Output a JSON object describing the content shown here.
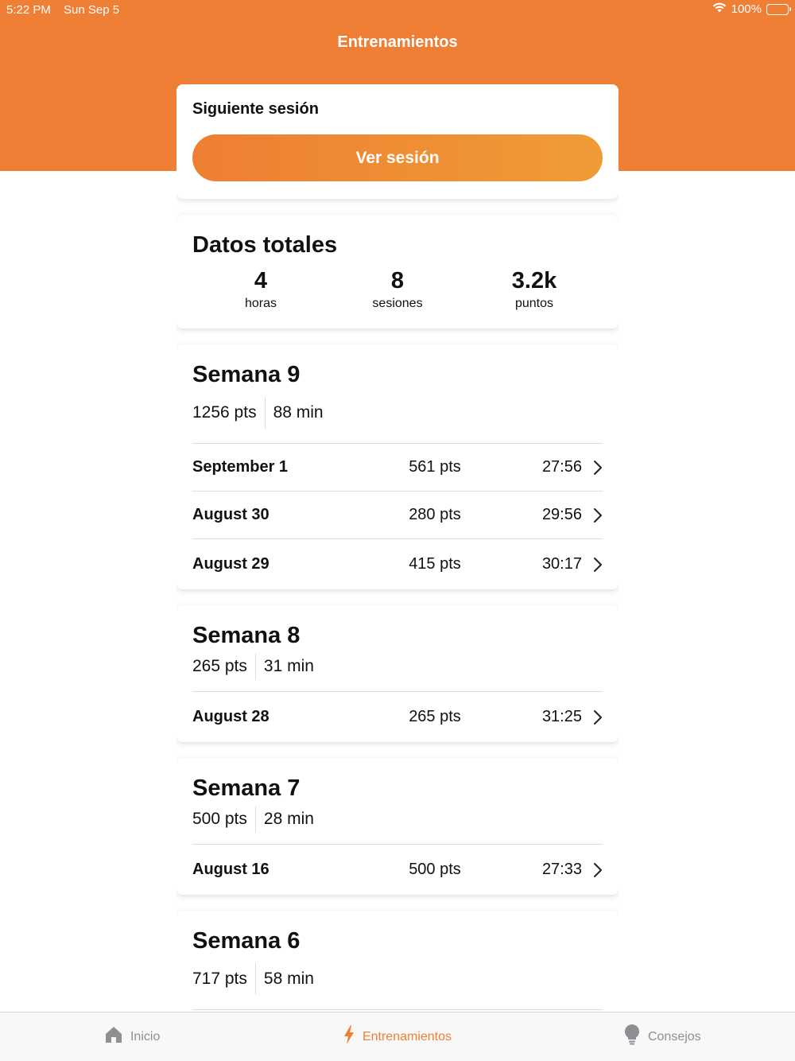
{
  "status": {
    "time": "5:22 PM",
    "date": "Sun Sep 5",
    "battery": "100%"
  },
  "nav": {
    "title": "Entrenamientos"
  },
  "next_session": {
    "label": "Siguiente sesión",
    "button": "Ver sesión"
  },
  "totals": {
    "title": "Datos totales",
    "stats": [
      {
        "value": "4",
        "label": "horas"
      },
      {
        "value": "8",
        "label": "sesiones"
      },
      {
        "value": "3.2k",
        "label": "puntos"
      }
    ]
  },
  "weeks": [
    {
      "title": "Semana 9",
      "pts": "1256 pts",
      "min": "88 min",
      "sessions": [
        {
          "date": "September 1",
          "pts": "561 pts",
          "time": "27:56"
        },
        {
          "date": "August 30",
          "pts": "280 pts",
          "time": "29:56"
        },
        {
          "date": "August 29",
          "pts": "415 pts",
          "time": "30:17"
        }
      ]
    },
    {
      "title": "Semana 8",
      "pts": "265 pts",
      "min": "31 min",
      "sessions": [
        {
          "date": "August 28",
          "pts": "265 pts",
          "time": "31:25"
        }
      ]
    },
    {
      "title": "Semana 7",
      "pts": "500 pts",
      "min": "28 min",
      "sessions": [
        {
          "date": "August 16",
          "pts": "500 pts",
          "time": "27:33"
        }
      ]
    },
    {
      "title": "Semana 6",
      "pts": "717 pts",
      "min": "58 min",
      "sessions": []
    }
  ],
  "tabs": [
    {
      "label": "Inicio",
      "icon": "house-icon"
    },
    {
      "label": "Entrenamientos",
      "icon": "bolt-icon"
    },
    {
      "label": "Consejos",
      "icon": "lightbulb-icon"
    }
  ],
  "colors": {
    "accent": "#EF7F35",
    "inactive": "#8E8E93"
  }
}
